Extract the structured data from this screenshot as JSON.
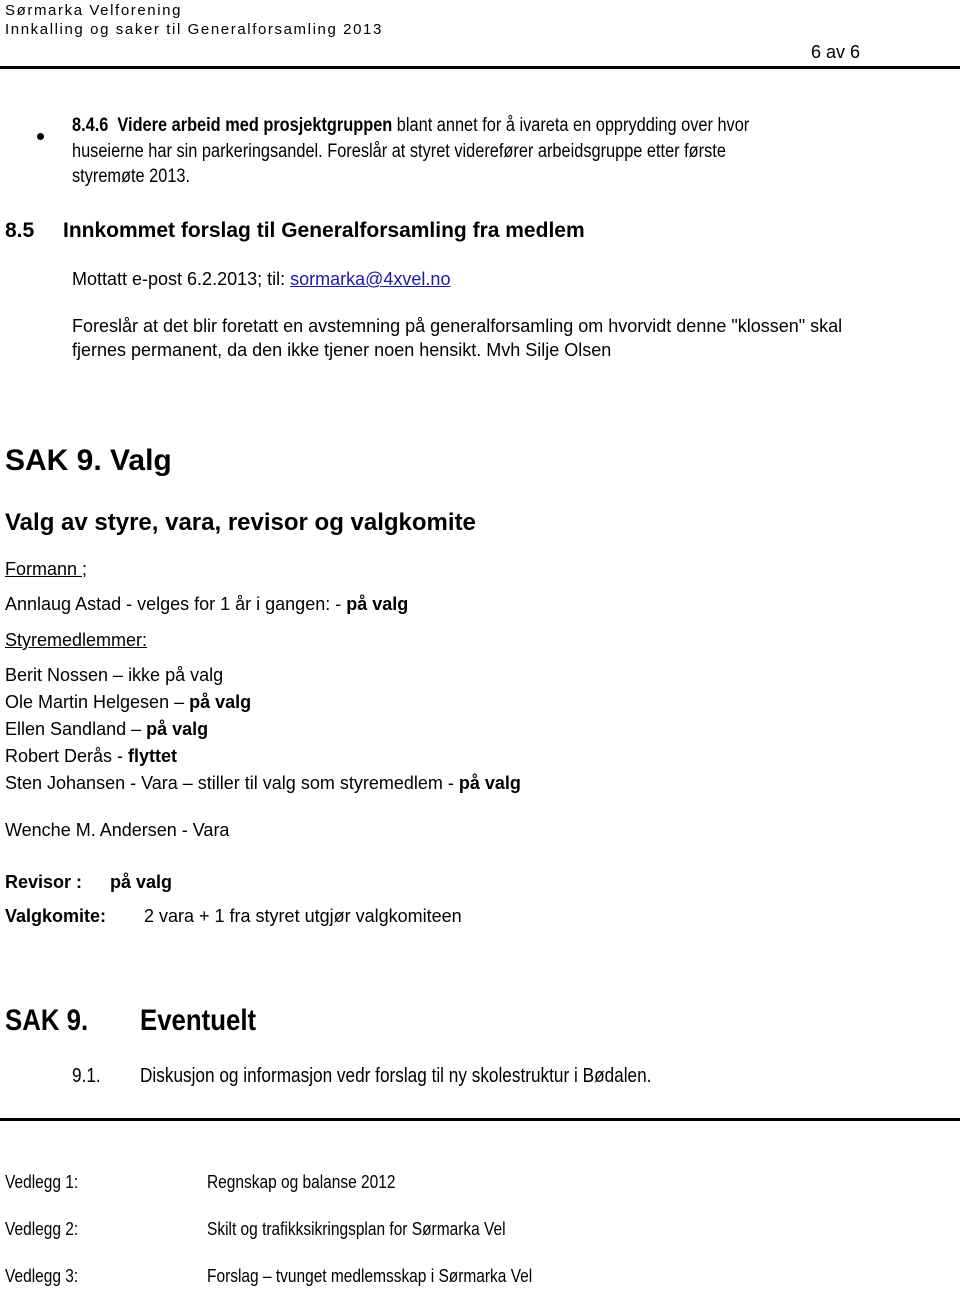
{
  "header": {
    "org_name": "Sørmarka Velforening",
    "doc_title": "Innkalling og saker til Generalforsamling 2013",
    "page_indicator": "6 av 6"
  },
  "item_846": {
    "number": "8.4.6",
    "bold_title": "Videre arbeid med prosjektgruppen",
    "line1_rest": " blant annet for å ivareta en opprydding over hvor",
    "line2": "huseierne har sin parkeringsandel. Foreslår at styret viderefører arbeidsgruppe etter første",
    "line3": "styremøte 2013."
  },
  "section_85": {
    "number": "8.5",
    "title": "Innkommet forslag til Generalforsamling fra medlem",
    "received_prefix": "Mottatt e-post 6.2.2013; til: ",
    "email_link": "sormarka@4xvel.no",
    "proposal_line1": "Foreslår at det blir foretatt en avstemning på generalforsamling om hvorvidt denne \"klossen\" skal",
    "proposal_line2": "fjernes permanent, da den ikke tjener noen hensikt.  Mvh  Silje Olsen"
  },
  "sak9_valg": {
    "heading": "SAK 9.  Valg",
    "subheading": "Valg av styre, vara, revisor og valgkomite",
    "formann_label": "Formann ;",
    "formann_line_prefix": "Annlaug Astad - velges for 1 år i gangen: - ",
    "formann_line_status": "på valg",
    "styre_label": "Styremedlemmer:",
    "members": [
      {
        "name": "Berit Nossen –  ",
        "status": "ikke på valg",
        "status_bold": false
      },
      {
        "name": "Ole Martin Helgesen –  ",
        "status": "på valg",
        "status_bold": true
      },
      {
        "name": "Ellen Sandland – ",
        "status": "på valg",
        "status_bold": true
      },
      {
        "name": "Robert Derås -  ",
        "status": "flyttet",
        "status_bold": true
      },
      {
        "name": "Sten Johansen - Vara – stiller til valg som styremedlem -  ",
        "status": "på valg",
        "status_bold": true
      }
    ],
    "vara_line": "Wenche M. Andersen - Vara",
    "revisor_label": "Revisor :",
    "revisor_status": "på valg",
    "valgkomite_label": "Valgkomite:",
    "valgkomite_text": "2 vara + 1 fra styret utgjør valgkomiteen"
  },
  "sak9_eventuelt": {
    "number": "SAK 9.",
    "title": "Eventuelt",
    "items": [
      {
        "number": "9.1.",
        "text": "Diskusjon og informasjon vedr forslag til ny skolestruktur i Bødalen."
      }
    ]
  },
  "attachments": [
    {
      "label": "Vedlegg 1:",
      "title": "Regnskap og balanse  2012"
    },
    {
      "label": "Vedlegg 2:",
      "title": "Skilt og trafikksikringsplan for Sørmarka Vel"
    },
    {
      "label": "Vedlegg 3:",
      "title": "Forslag – tvunget medlemsskap i Sørmarka Vel"
    }
  ]
}
